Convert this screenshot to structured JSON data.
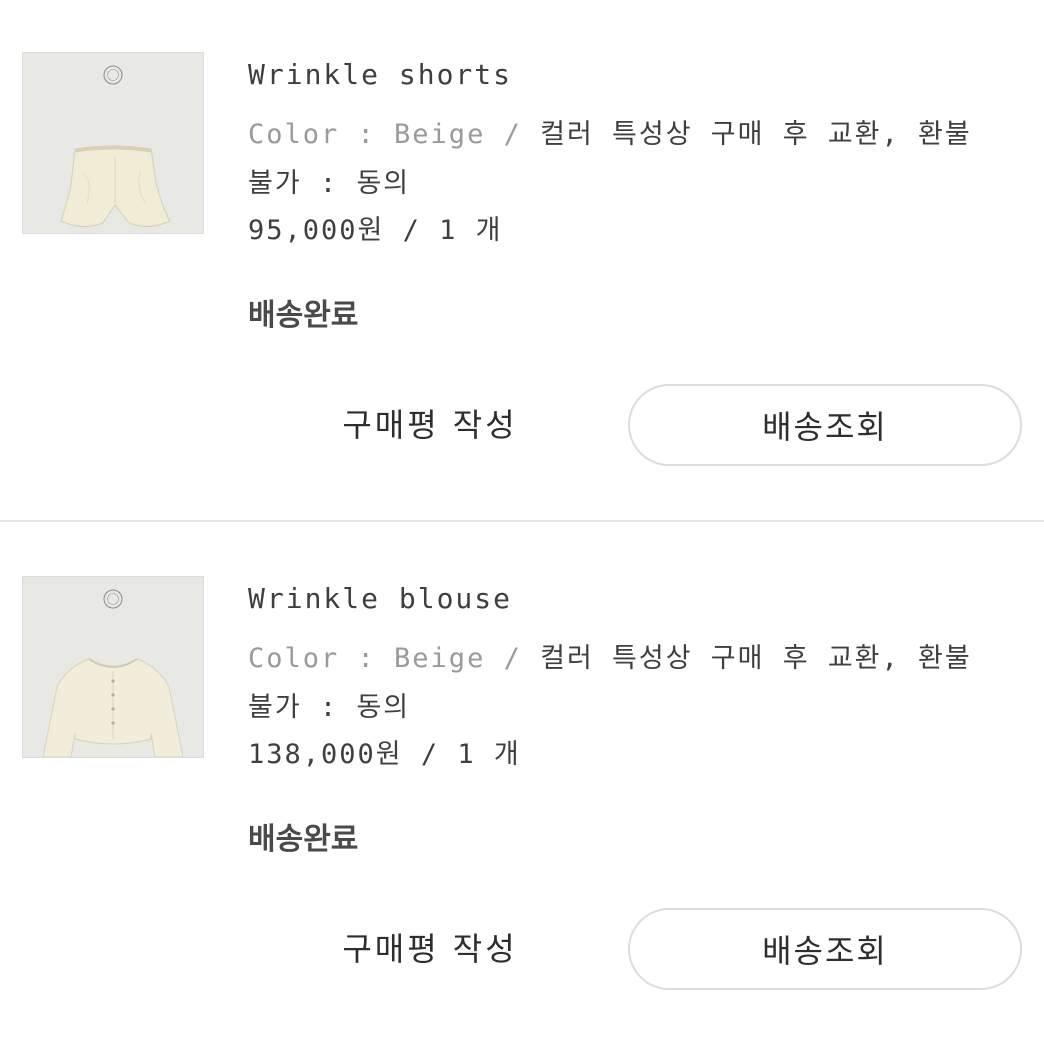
{
  "orders": [
    {
      "product_name": "Wrinkle shorts",
      "option_label": "Color : Beige /",
      "option_text": " 컬러 특성상 구매 후 교환, 환불",
      "option_text_cont": "불가 : 동의",
      "price": "95,000원 / 1 개",
      "status": "배송완료",
      "review_button": "구매평 작성",
      "track_button": "배송조회",
      "thumbnail_icon": "shorts-product-image",
      "thumbnail_color": "#f1ecd6"
    },
    {
      "product_name": "Wrinkle blouse",
      "option_label": "Color : Beige /",
      "option_text": " 컬러 특성상 구매 후 교환, 환불",
      "option_text_cont": "불가 : 동의",
      "price": "138,000원 / 1 개",
      "status": "배송완료",
      "review_button": "구매평 작성",
      "track_button": "배송조회",
      "thumbnail_icon": "blouse-product-image",
      "thumbnail_color": "#f2edda"
    }
  ]
}
